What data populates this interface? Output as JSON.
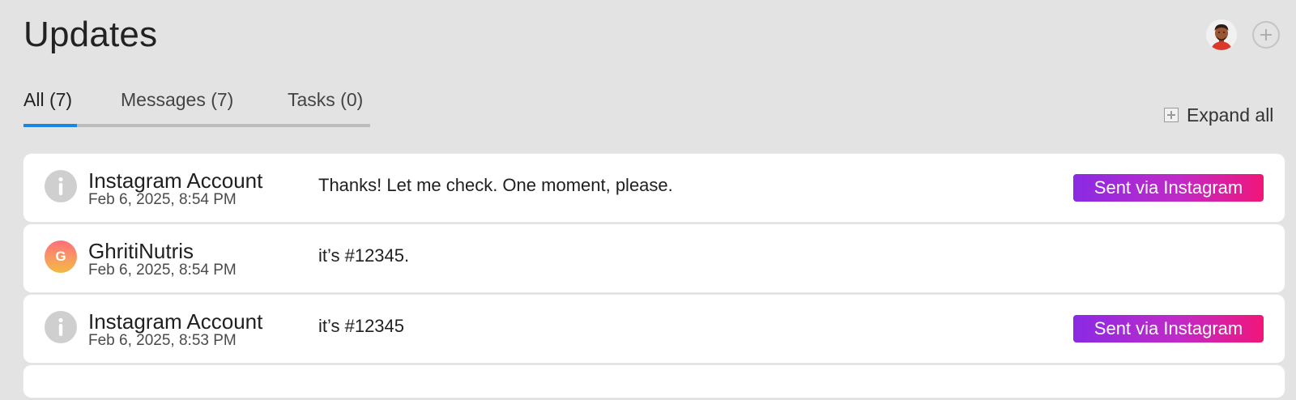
{
  "header": {
    "title": "Updates",
    "avatar_icon": "user-avatar",
    "add_icon": "plus-icon"
  },
  "tabs": [
    {
      "label": "All (7)",
      "active": true
    },
    {
      "label": "Messages (7)",
      "active": false
    },
    {
      "label": "Tasks (0)",
      "active": false
    }
  ],
  "toolbar": {
    "expand_all_label": "Expand all",
    "expand_icon": "expand-square-icon"
  },
  "colors": {
    "accent": "#1a86e0",
    "badge_gradient_start": "#8a2ae3",
    "badge_gradient_end": "#f0167a",
    "background": "#e3e3e3"
  },
  "updates": [
    {
      "sender": "Instagram Account",
      "timestamp": "Feb 6, 2025, 8:54 PM",
      "message": "Thanks! Let me check. One moment, please.",
      "icon": "info-icon",
      "badge": "Sent via Instagram"
    },
    {
      "sender": "GhritiNutris",
      "timestamp": "Feb 6, 2025, 8:54 PM",
      "message": "it’s #12345.",
      "icon": "avatar",
      "avatar_initial": "G",
      "badge": null
    },
    {
      "sender": "Instagram Account",
      "timestamp": "Feb 6, 2025, 8:53 PM",
      "message": "it’s #12345",
      "icon": "info-icon",
      "badge": "Sent via Instagram"
    }
  ]
}
